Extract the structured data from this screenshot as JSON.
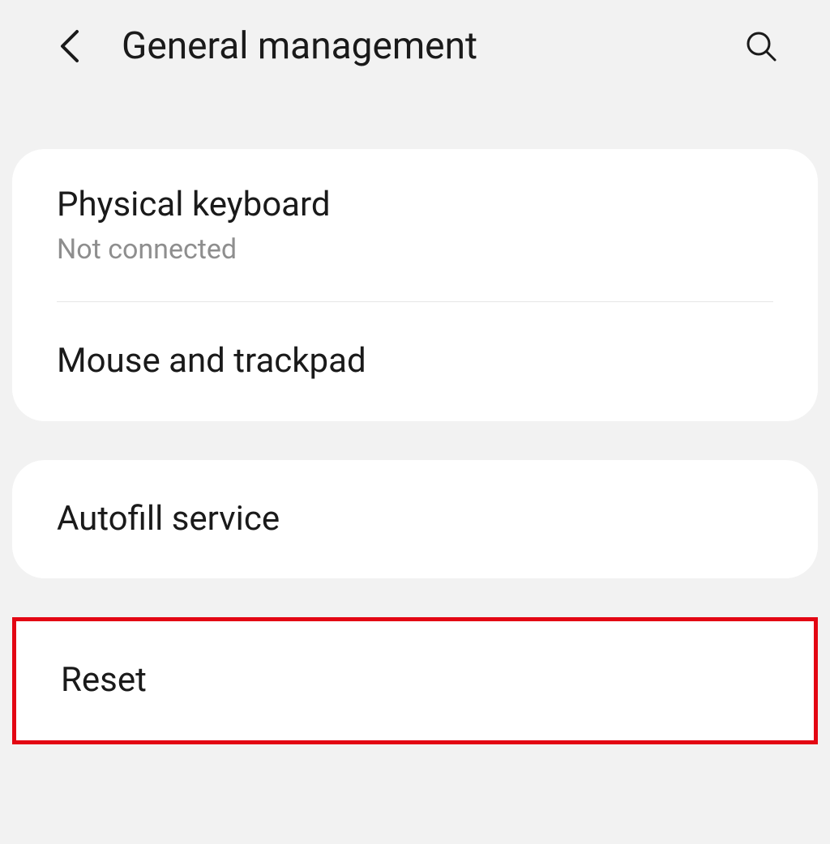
{
  "header": {
    "title": "General management"
  },
  "groups": [
    {
      "items": [
        {
          "title": "Physical keyboard",
          "subtitle": "Not connected"
        },
        {
          "title": "Mouse and trackpad"
        }
      ]
    },
    {
      "items": [
        {
          "title": "Autofill service"
        }
      ]
    },
    {
      "highlight": true,
      "items": [
        {
          "title": "Reset"
        }
      ]
    }
  ]
}
